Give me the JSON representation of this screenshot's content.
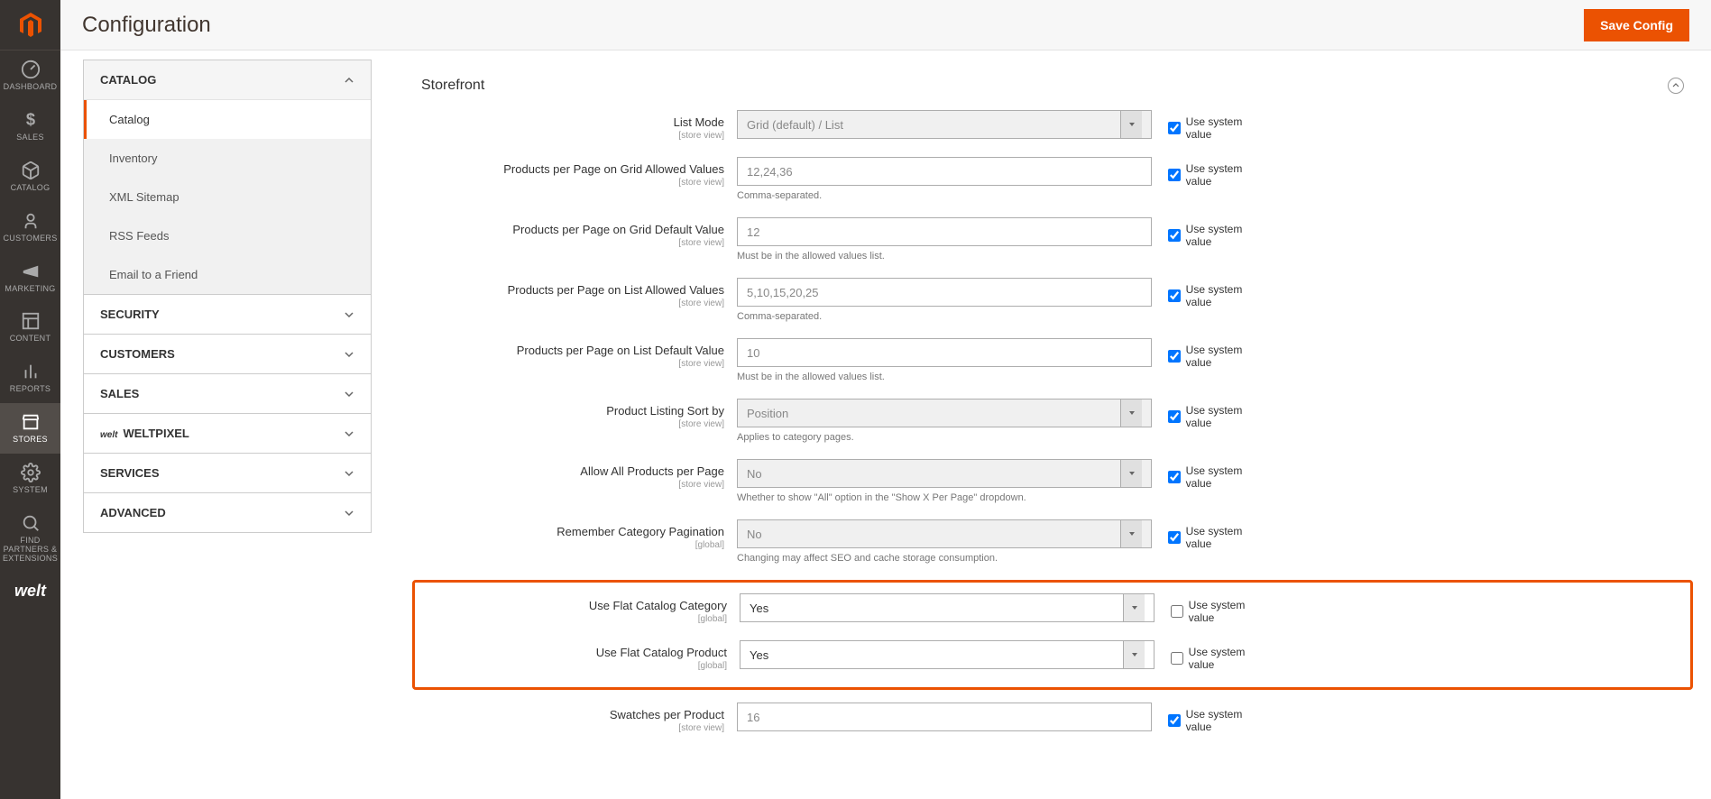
{
  "page_title": "Configuration",
  "save_button": "Save Config",
  "admin_nav": [
    {
      "key": "dashboard",
      "label": "DASHBOARD"
    },
    {
      "key": "sales",
      "label": "SALES"
    },
    {
      "key": "catalog",
      "label": "CATALOG"
    },
    {
      "key": "customers",
      "label": "CUSTOMERS"
    },
    {
      "key": "marketing",
      "label": "MARKETING"
    },
    {
      "key": "content",
      "label": "CONTENT"
    },
    {
      "key": "reports",
      "label": "REPORTS"
    },
    {
      "key": "stores",
      "label": "STORES"
    },
    {
      "key": "system",
      "label": "SYSTEM"
    },
    {
      "key": "partners",
      "label": "FIND PARTNERS & EXTENSIONS"
    }
  ],
  "config_sections": {
    "catalog": {
      "label": "CATALOG",
      "items": [
        {
          "key": "catalog",
          "label": "Catalog"
        },
        {
          "key": "inventory",
          "label": "Inventory"
        },
        {
          "key": "xml-sitemap",
          "label": "XML Sitemap"
        },
        {
          "key": "rss-feeds",
          "label": "RSS Feeds"
        },
        {
          "key": "email-friend",
          "label": "Email to a Friend"
        }
      ]
    },
    "security": {
      "label": "SECURITY"
    },
    "customers": {
      "label": "CUSTOMERS"
    },
    "sales": {
      "label": "SALES"
    },
    "weltpixel": {
      "label": "WELTPIXEL"
    },
    "services": {
      "label": "SERVICES"
    },
    "advanced": {
      "label": "ADVANCED"
    }
  },
  "fieldset_title": "Storefront",
  "scope_store": "[store view]",
  "scope_global": "[global]",
  "system_value_label": "Use system value",
  "fields": {
    "list_mode": {
      "label": "List Mode",
      "value": "Grid (default) / List"
    },
    "grid_allowed": {
      "label": "Products per Page on Grid Allowed Values",
      "value": "12,24,36",
      "note": "Comma-separated."
    },
    "grid_default": {
      "label": "Products per Page on Grid Default Value",
      "value": "12",
      "note": "Must be in the allowed values list."
    },
    "list_allowed": {
      "label": "Products per Page on List Allowed Values",
      "value": "5,10,15,20,25",
      "note": "Comma-separated."
    },
    "list_default": {
      "label": "Products per Page on List Default Value",
      "value": "10",
      "note": "Must be in the allowed values list."
    },
    "sort_by": {
      "label": "Product Listing Sort by",
      "value": "Position",
      "note": "Applies to category pages."
    },
    "allow_all": {
      "label": "Allow All Products per Page",
      "value": "No",
      "note": "Whether to show \"All\" option in the \"Show X Per Page\" dropdown."
    },
    "remember_pagination": {
      "label": "Remember Category Pagination",
      "value": "No",
      "note": "Changing may affect SEO and cache storage consumption."
    },
    "flat_category": {
      "label": "Use Flat Catalog Category",
      "value": "Yes"
    },
    "flat_product": {
      "label": "Use Flat Catalog Product",
      "value": "Yes"
    },
    "swatches": {
      "label": "Swatches per Product",
      "value": "16"
    }
  }
}
